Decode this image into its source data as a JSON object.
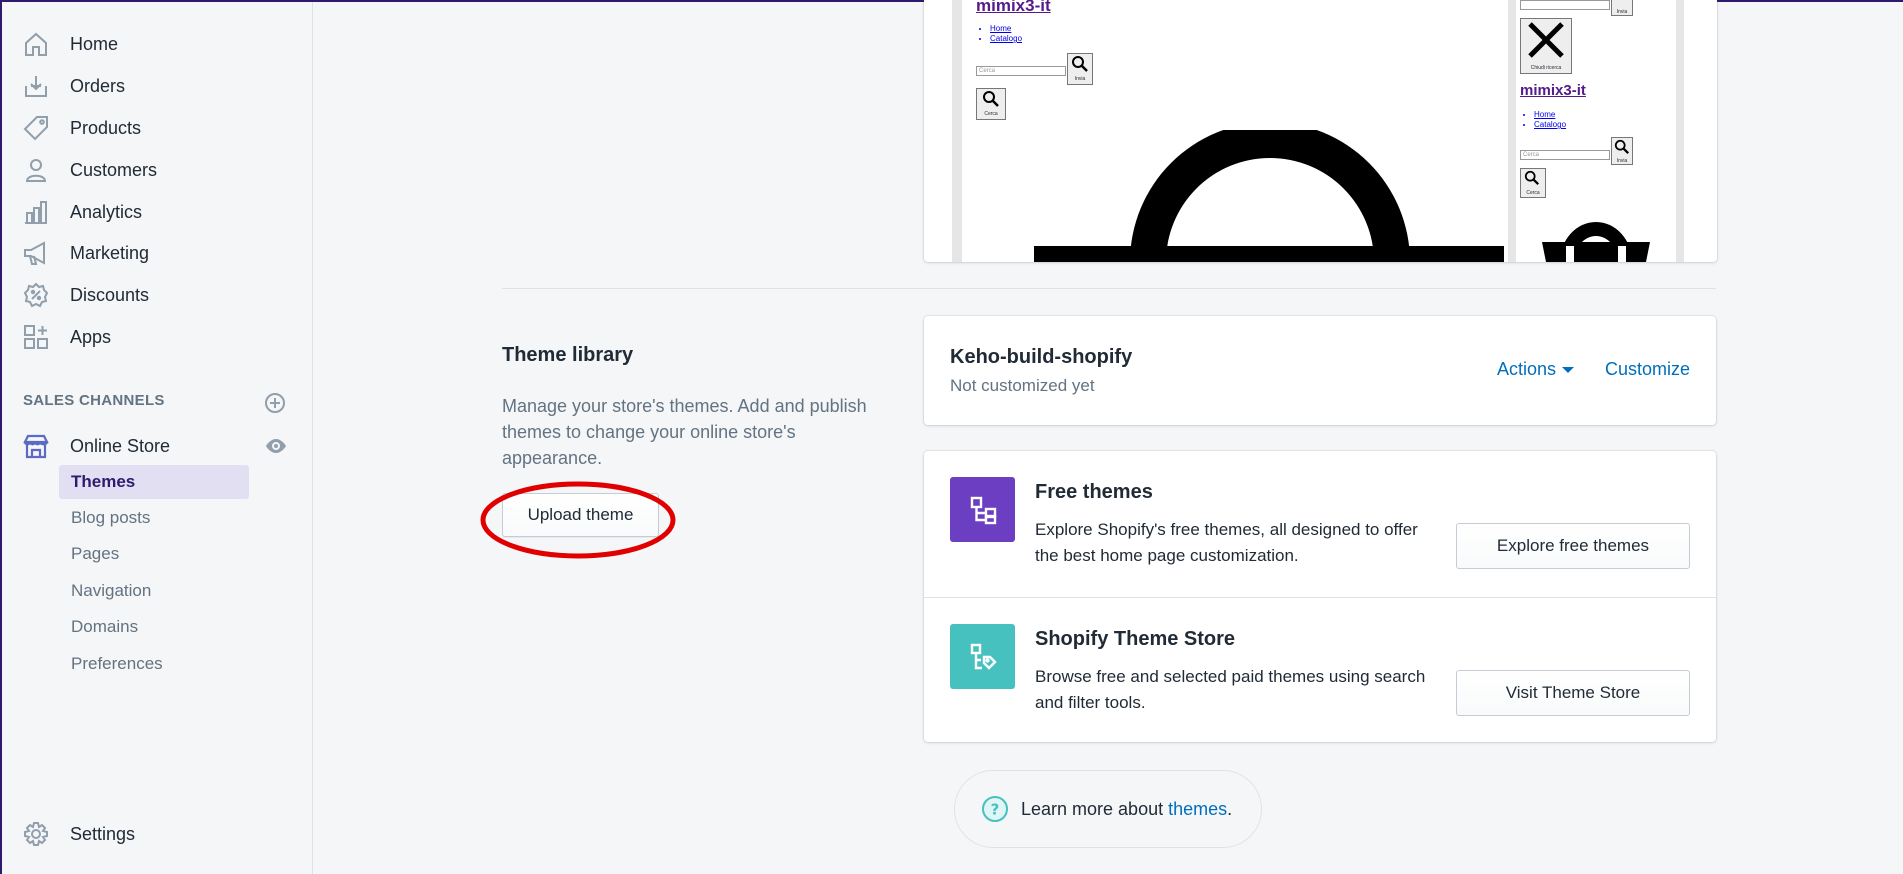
{
  "sidebar": {
    "items": [
      {
        "label": "Home",
        "icon": "home-icon"
      },
      {
        "label": "Orders",
        "icon": "orders-icon"
      },
      {
        "label": "Products",
        "icon": "tag-icon"
      },
      {
        "label": "Customers",
        "icon": "person-icon"
      },
      {
        "label": "Analytics",
        "icon": "bar-chart-icon"
      },
      {
        "label": "Marketing",
        "icon": "megaphone-icon"
      },
      {
        "label": "Discounts",
        "icon": "discount-icon"
      },
      {
        "label": "Apps",
        "icon": "apps-icon"
      }
    ],
    "channels_title": "SALES CHANNELS",
    "online_store": "Online Store",
    "sub_items": [
      "Themes",
      "Blog posts",
      "Pages",
      "Navigation",
      "Domains",
      "Preferences"
    ],
    "active_sub_item": "Themes",
    "settings": "Settings"
  },
  "preview": {
    "desktop_title": "mimix3-it",
    "desktop_links": [
      "Home",
      "Catalogo"
    ],
    "desktop_search_placeholder": "Cerca",
    "desktop_submit": "Invia",
    "desktop_search_button": "Cerca",
    "mobile_close": "Chiudi ricerca",
    "mobile_title": "mimix3-it",
    "mobile_links": [
      "Home",
      "Catalogo"
    ],
    "mobile_search_placeholder": "Cerca",
    "mobile_submit": "Invia",
    "mobile_search_button": "Cerca"
  },
  "theme_library": {
    "title": "Theme library",
    "description": "Manage your store's themes. Add and publish themes to change your online store's appearance.",
    "upload_button": "Upload theme"
  },
  "current_theme": {
    "name": "Keho-build-shopify",
    "status": "Not customized yet",
    "actions": "Actions",
    "customize": "Customize"
  },
  "theme_stores": [
    {
      "title": "Free themes",
      "description": "Explore Shopify's free themes, all designed to offer the best home page customization.",
      "button": "Explore free themes",
      "icon": "free-themes-icon",
      "color": "#6c3ec1"
    },
    {
      "title": "Shopify Theme Store",
      "description": "Browse free and selected paid themes using search and filter tools.",
      "button": "Visit Theme Store",
      "icon": "theme-store-icon",
      "color": "#47c1bf"
    }
  ],
  "learn_more": {
    "text": "Learn more about",
    "link": "themes",
    "suffix": "."
  },
  "colors": {
    "accent": "#2e1a6e",
    "link": "#006fbb",
    "annotation": "#e00000"
  }
}
